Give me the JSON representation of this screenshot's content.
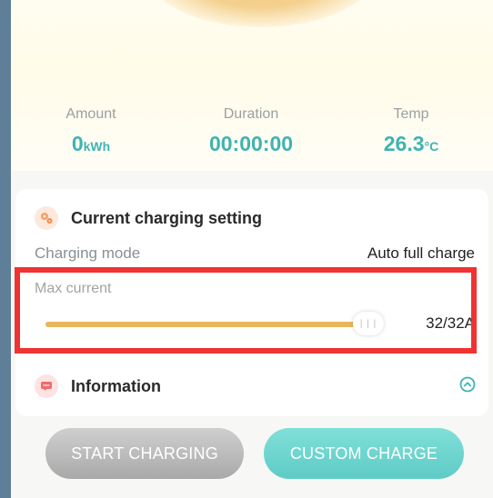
{
  "stats": [
    {
      "label": "Amount",
      "value": "0",
      "unit": "kWh"
    },
    {
      "label": "Duration",
      "value": "00:00:00",
      "unit": ""
    },
    {
      "label": "Temp",
      "value": "26.3",
      "unit": "°C"
    }
  ],
  "settings": {
    "title": "Current charging setting",
    "charging_mode_label": "Charging mode",
    "charging_mode_value": "Auto full charge",
    "max_current_label": "Max current",
    "max_current_value": "32/32A",
    "max_current_fraction": 1.0
  },
  "information": {
    "title": "Information"
  },
  "buttons": {
    "start": "START CHARGING",
    "custom": "CUSTOM CHARGE"
  },
  "icons": {
    "settings": "gear-icon",
    "information": "info-card-icon",
    "expand": "chevron-up-circle-icon",
    "slider_thumb": "slider-grip-icon"
  },
  "colors": {
    "accent": "#3fb3b3",
    "slider": "#e8b75c",
    "highlight": "#f03232",
    "start_btn": "#b4b4b4",
    "custom_btn": "#66d1cc"
  }
}
